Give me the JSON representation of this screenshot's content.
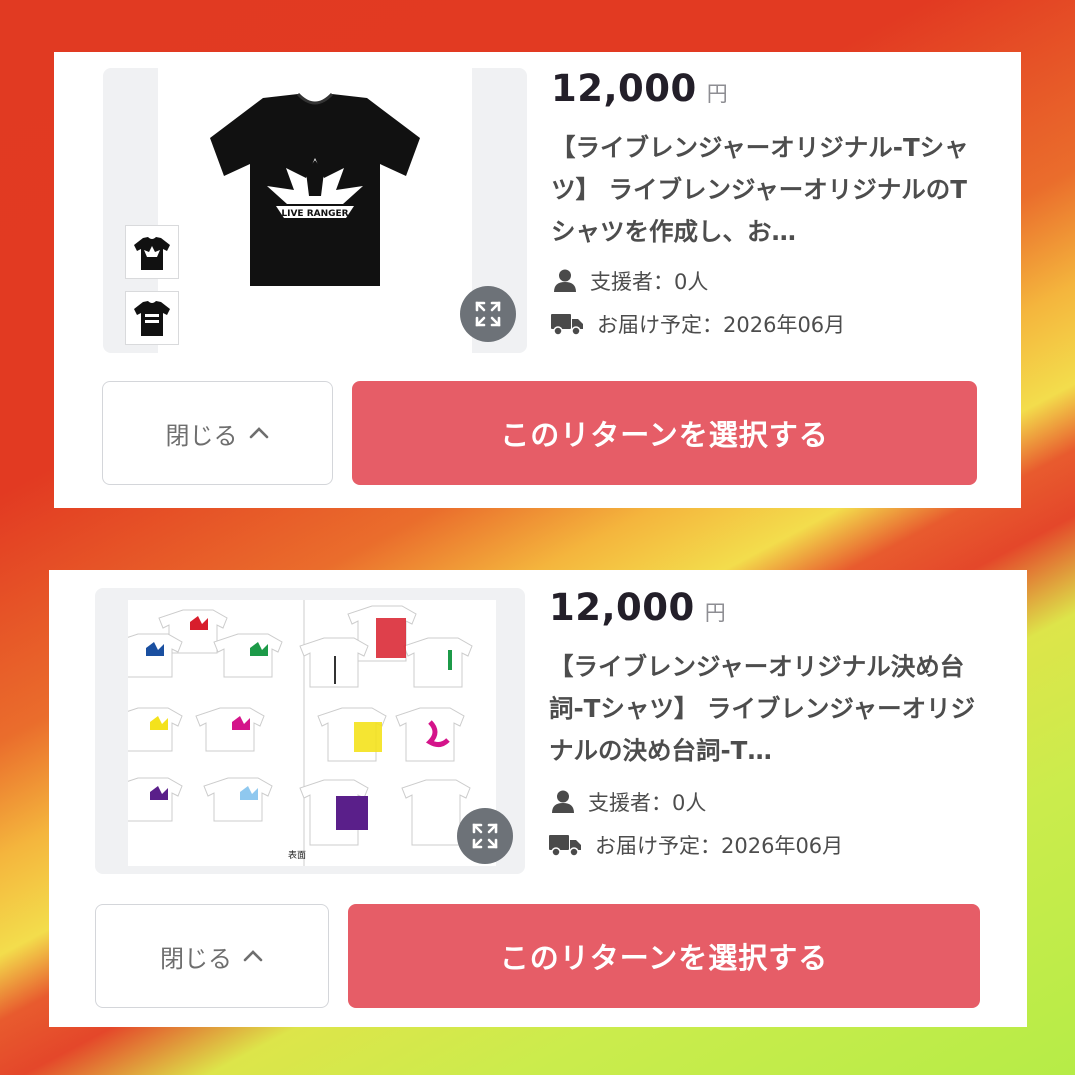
{
  "items": [
    {
      "price": "12,000",
      "currency": "円",
      "title": "【ライブレンジャーオリジナル-Tシャツ】 ライブレンジャーオリジナルのTシャツを作成し、お…",
      "supporters": "支援者：0人",
      "delivery": "お届け予定：2026年06月",
      "close_label": "閉じる",
      "select_label": "このリターンを選択する",
      "image_text": "LIVE RANGER"
    },
    {
      "price": "12,000",
      "currency": "円",
      "title": "【ライブレンジャーオリジナル決め台詞-Tシャツ】 ライブレンジャーオリジナルの決め台詞-T…",
      "supporters": "支援者：0人",
      "delivery": "お届け予定：2026年06月",
      "close_label": "閉じる",
      "select_label": "このリターンを選択する",
      "image_caption": "表面"
    }
  ],
  "icons": [
    "person-icon",
    "truck-icon",
    "expand-icon",
    "chevron-up-icon"
  ],
  "colors": {
    "select_button": "#e65d67",
    "expand_button": "#6d7278",
    "text_dark": "#231f29"
  }
}
